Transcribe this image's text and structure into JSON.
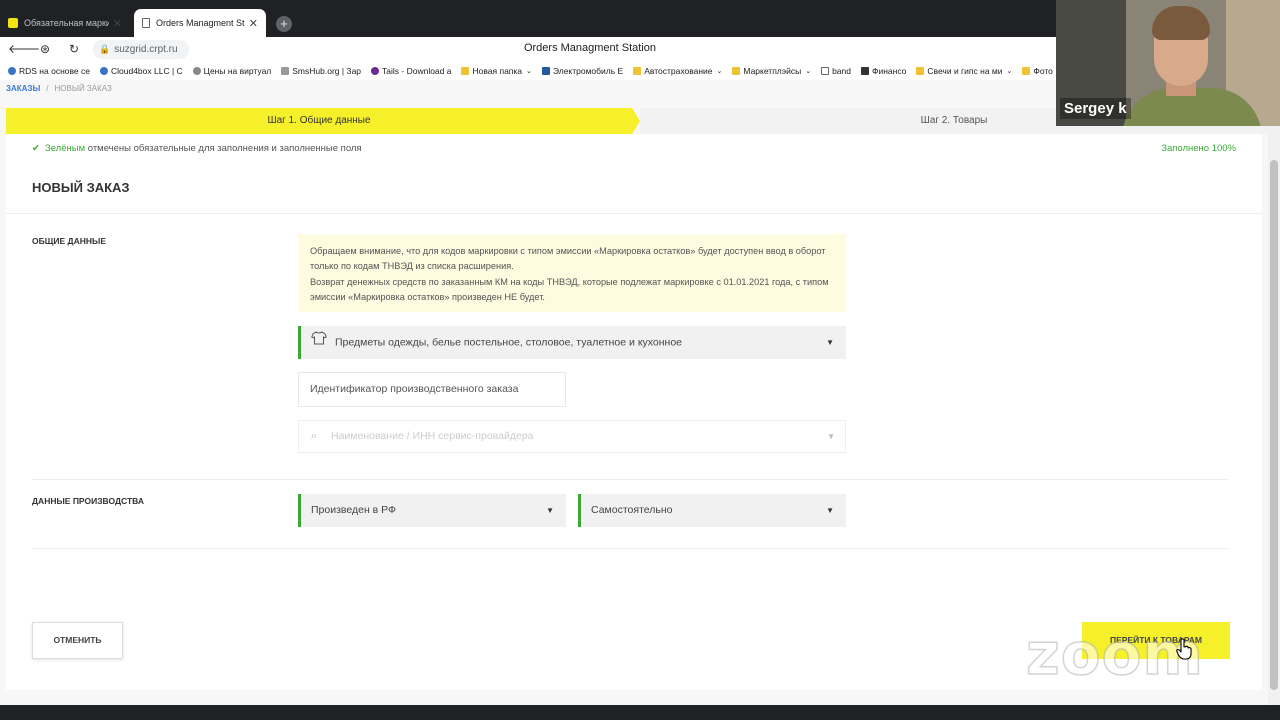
{
  "browser": {
    "tabs": [
      {
        "title": "Обязательная маркировк"
      },
      {
        "title": "Orders Managment Stat"
      }
    ],
    "new_tab": "+",
    "close_glyph": "✕",
    "url": "suzgrid.crpt.ru",
    "page_title": "Orders Managment Station",
    "bookmarks": [
      {
        "label": "RDS на основе се"
      },
      {
        "label": "Cloud4box LLC | C"
      },
      {
        "label": "Цены на виртуал"
      },
      {
        "label": "SmsHub.org | Зар"
      },
      {
        "label": "Tails - Download a"
      },
      {
        "label": "Новая папка"
      },
      {
        "label": "Электромобиль Е"
      },
      {
        "label": "Автострахование"
      },
      {
        "label": "Маркетплэйсы"
      },
      {
        "label": "band"
      },
      {
        "label": "Финансо"
      },
      {
        "label": "Свечи и гипс на ми"
      },
      {
        "label": "Фото"
      }
    ]
  },
  "breadcrumb": {
    "parent": "ЗАКАЗЫ",
    "separator": "/",
    "current": "НОВЫЙ ЗАКАЗ"
  },
  "steps": {
    "step1": "Шаг 1. Общие данные",
    "step2": "Шаг 2. Товары"
  },
  "form": {
    "hint_highlight": "Зелёным",
    "hint_rest": " отмечены обязательные для заполнения и заполненные поля",
    "progress": "Заполнено 100%",
    "title": "НОВЫЙ ЗАКАЗ",
    "section_general": "ОБЩИЕ ДАННЫЕ",
    "notice_p1": "Обращаем внимание, что для кодов маркировки с типом эмиссии «Маркировка остатков» будет доступен ввод в оборот только по кодам ТНВЭД из списка расширения.",
    "notice_p2": "Возврат денежных средств по заказанным КМ на коды ТНВЭД, которые подлежат маркировке с 01.01.2021 года, с типом эмиссии «Маркировка остатков» произведен НЕ будет.",
    "product_group": "Предметы одежды, белье постельное, столовое, туалетное и кухонное",
    "order_id_placeholder": "Идентификатор производственного заказа",
    "provider_placeholder": "Наименование / ИНН сервис-провайдера",
    "section_production": "ДАННЫЕ ПРОИЗВОДСТВА",
    "production_country": "Произведен в РФ",
    "production_method": "Самостоятельно",
    "cancel": "ОТМЕНИТЬ",
    "next": "ПЕРЕЙТИ К ТОВАРАМ"
  },
  "overlay": {
    "zoom_watermark": "zoom",
    "participant_name": "Sergey k"
  },
  "colors": {
    "accent_yellow": "#f5f02a",
    "ok_green": "#3aaa35",
    "notice_bg": "#fdfbe0"
  }
}
